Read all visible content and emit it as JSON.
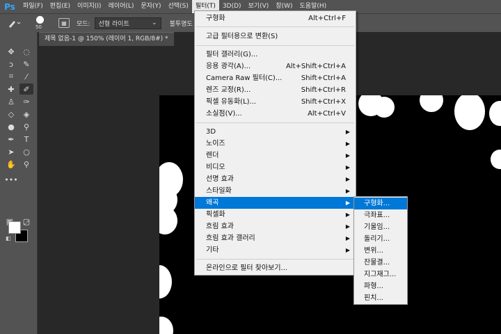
{
  "menubar": {
    "logo": "Ps",
    "items": [
      "파일(F)",
      "편집(E)",
      "이미지(I)",
      "레이어(L)",
      "문자(Y)",
      "선택(S)",
      "필터(T)",
      "3D(D)",
      "보기(V)",
      "창(W)",
      "도움말(H)"
    ],
    "active_index": 6
  },
  "options": {
    "brush_size": "50",
    "mode_label": "모드:",
    "mode_value": "선형 라이트",
    "opacity_label": "불투명도"
  },
  "document": {
    "tab_title": "제목 없음-1 @ 150% (레이어 1, RGB/8#) *"
  },
  "filter_menu": {
    "items": [
      {
        "label": "구형화",
        "shortcut": "Alt+Ctrl+F",
        "submenu": false
      },
      {
        "separator": true
      },
      {
        "label": "고급 필터용으로 변환(S)",
        "shortcut": "",
        "submenu": false
      },
      {
        "separator": true
      },
      {
        "label": "필터 갤러리(G)...",
        "shortcut": "",
        "submenu": false
      },
      {
        "label": "응용 광각(A)...",
        "shortcut": "Alt+Shift+Ctrl+A",
        "submenu": false
      },
      {
        "label": "Camera Raw 필터(C)...",
        "shortcut": "Shift+Ctrl+A",
        "submenu": false
      },
      {
        "label": "렌즈 교정(R)...",
        "shortcut": "Shift+Ctrl+R",
        "submenu": false
      },
      {
        "label": "픽셀 유동화(L)...",
        "shortcut": "Shift+Ctrl+X",
        "submenu": false
      },
      {
        "label": "소실점(V)...",
        "shortcut": "Alt+Ctrl+V",
        "submenu": false
      },
      {
        "separator": true
      },
      {
        "label": "3D",
        "shortcut": "",
        "submenu": true
      },
      {
        "label": "노이즈",
        "shortcut": "",
        "submenu": true
      },
      {
        "label": "렌더",
        "shortcut": "",
        "submenu": true
      },
      {
        "label": "비디오",
        "shortcut": "",
        "submenu": true
      },
      {
        "label": "선명 효과",
        "shortcut": "",
        "submenu": true
      },
      {
        "label": "스타일화",
        "shortcut": "",
        "submenu": true
      },
      {
        "label": "왜곡",
        "shortcut": "",
        "submenu": true,
        "highlighted": true
      },
      {
        "label": "픽셀화",
        "shortcut": "",
        "submenu": true
      },
      {
        "label": "흐림 효과",
        "shortcut": "",
        "submenu": true
      },
      {
        "label": "흐림 효과 갤러리",
        "shortcut": "",
        "submenu": true
      },
      {
        "label": "기타",
        "shortcut": "",
        "submenu": true
      },
      {
        "separator": true
      },
      {
        "label": "온라인으로 필터 찾아보기...",
        "shortcut": "",
        "submenu": false
      }
    ]
  },
  "distort_submenu": {
    "items": [
      "구형화...",
      "극좌표...",
      "기울임...",
      "돌리기...",
      "변위...",
      "잔물결...",
      "지그재그...",
      "파형...",
      "핀치..."
    ],
    "highlighted_index": 0
  },
  "colors": {
    "accent": "#0078d7",
    "ps_blue": "#31a8ff",
    "chrome": "#535353"
  }
}
